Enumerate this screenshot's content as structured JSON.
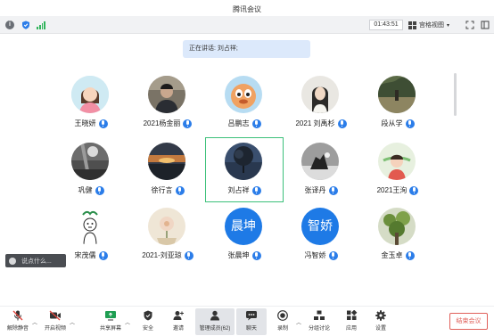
{
  "window": {
    "title": "腾讯会议"
  },
  "infobar": {
    "timer": "01:43:51",
    "view_label": "宫格视图"
  },
  "speaking": {
    "text": "正在讲话: 刘占祥;"
  },
  "participants": [
    {
      "name": "王晓妍",
      "avatar": ""
    },
    {
      "name": "2021杨金丽",
      "avatar": ""
    },
    {
      "name": "吕鹏志",
      "avatar": ""
    },
    {
      "name": "2021 刘禹杉",
      "avatar": ""
    },
    {
      "name": "段从学",
      "avatar": ""
    },
    {
      "name": "巩健",
      "avatar": ""
    },
    {
      "name": "徐行言",
      "avatar": ""
    },
    {
      "name": "刘占祥",
      "avatar": ""
    },
    {
      "name": "张译丹",
      "avatar": ""
    },
    {
      "name": "2021王洵",
      "avatar": ""
    },
    {
      "name": "宋茂儒",
      "avatar": ""
    },
    {
      "name": "2021-刘亚琼",
      "avatar": ""
    },
    {
      "name": "张晨坤",
      "avatar": "晨坤"
    },
    {
      "name": "冯智娇",
      "avatar": "智娇"
    },
    {
      "name": "金玉卓",
      "avatar": ""
    }
  ],
  "chat": {
    "placeholder": "说点什么..."
  },
  "toolbar": {
    "unmute": "解除静音",
    "video": "开启视频",
    "share": "共享屏幕",
    "security": "安全",
    "invite": "邀请",
    "members": "管理成员(62)",
    "chat": "聊天",
    "record": "录制",
    "breakout": "分组讨论",
    "apps": "应用",
    "settings": "设置",
    "end": "结束会议"
  },
  "colors": {
    "accent": "#2b7de9",
    "active_border": "#3cc07a",
    "end": "#e0605a"
  }
}
